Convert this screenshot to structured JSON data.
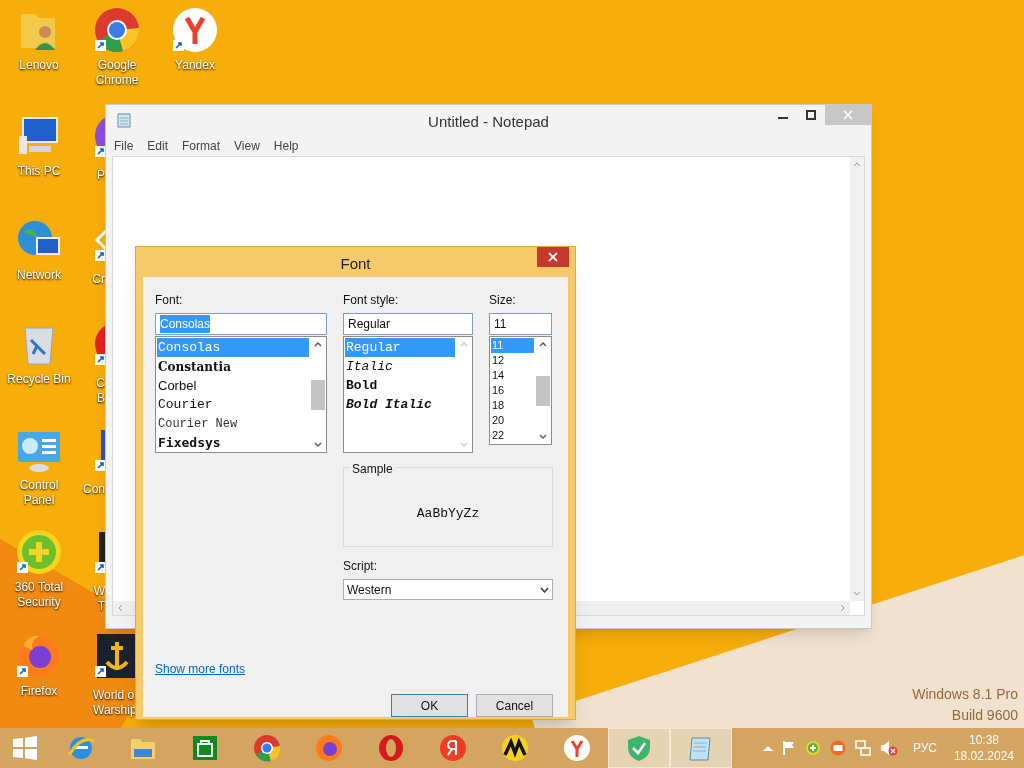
{
  "desktop_icons": [
    {
      "label": "Lenovo"
    },
    {
      "label": "Google Chrome"
    },
    {
      "label": "Yandex"
    },
    {
      "label": "This PC"
    },
    {
      "label": "Network"
    },
    {
      "label": "Recycle Bin"
    },
    {
      "label": "Control Panel"
    },
    {
      "label": "360 Total Security"
    },
    {
      "label": "Firefox"
    }
  ],
  "covered_icons": [
    {
      "lines": [
        "P"
      ]
    },
    {
      "lines": [
        "Cr"
      ]
    },
    {
      "lines": [
        "C",
        "B"
      ]
    },
    {
      "lines": [
        "Con"
      ]
    },
    {
      "lines": [
        "W",
        "T"
      ]
    },
    {
      "lines": [
        "World o",
        "Warship"
      ]
    }
  ],
  "notepad": {
    "title": "Untitled - Notepad",
    "menu": [
      "File",
      "Edit",
      "Format",
      "View",
      "Help"
    ]
  },
  "font_dialog": {
    "title": "Font",
    "font": {
      "label": "Font:",
      "value": "Consolas",
      "items": [
        {
          "label": "Consolas",
          "kind": "mono",
          "selected": true
        },
        {
          "label": "Constantia",
          "kind": "serifbold",
          "selected": false
        },
        {
          "label": "Corbel",
          "kind": "sans",
          "selected": false
        },
        {
          "label": "Courier",
          "kind": "mono",
          "selected": false
        },
        {
          "label": "Courier New",
          "kind": "monolight",
          "selected": false
        },
        {
          "label": "Fixedsys",
          "kind": "monobold",
          "selected": false
        }
      ]
    },
    "style": {
      "label": "Font style:",
      "value": "Regular",
      "items": [
        {
          "label": "Regular",
          "kind": "regular",
          "selected": true
        },
        {
          "label": "Italic",
          "kind": "italic",
          "selected": false
        },
        {
          "label": "Bold",
          "kind": "bold",
          "selected": false
        },
        {
          "label": "Bold Italic",
          "kind": "bolditalic",
          "selected": false
        }
      ]
    },
    "size": {
      "label": "Size:",
      "value": "11",
      "items": [
        {
          "label": "11",
          "selected": true
        },
        {
          "label": "12",
          "selected": false
        },
        {
          "label": "14",
          "selected": false
        },
        {
          "label": "16",
          "selected": false
        },
        {
          "label": "18",
          "selected": false
        },
        {
          "label": "20",
          "selected": false
        },
        {
          "label": "22",
          "selected": false
        }
      ]
    },
    "sample": {
      "label": "Sample",
      "text": "AaBbYyZz"
    },
    "script": {
      "label": "Script:",
      "value": "Western"
    },
    "link": "Show more fonts",
    "buttons": [
      "OK",
      "Cancel"
    ]
  },
  "watermark": [
    "Windows 8.1 Pro",
    "Build 9600"
  ],
  "taskbar": {
    "items": [
      {
        "open": false
      },
      {
        "open": false
      },
      {
        "open": false
      },
      {
        "open": false
      },
      {
        "open": false
      },
      {
        "open": false
      },
      {
        "open": false
      },
      {
        "open": false
      },
      {
        "open": false
      },
      {
        "open": true
      },
      {
        "open": true
      }
    ],
    "language": "РУС",
    "time": "10:38",
    "date": "18.02.2024"
  }
}
